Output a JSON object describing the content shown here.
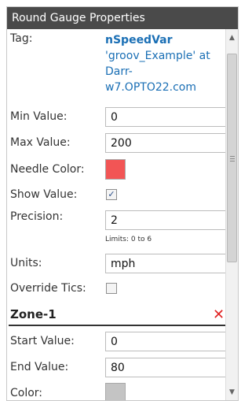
{
  "panel": {
    "title": "Round Gauge Properties"
  },
  "tag": {
    "label": "Tag:",
    "name": "nSpeedVar",
    "source_line1": "'groov_Example' at",
    "source_line2": "Darr-",
    "source_line3": "w7.OPTO22.com"
  },
  "min_value": {
    "label": "Min Value:",
    "value": "0"
  },
  "max_value": {
    "label": "Max Value:",
    "value": "200"
  },
  "needle_color": {
    "label": "Needle Color:",
    "color": "#f25555"
  },
  "show_value": {
    "label": "Show Value:",
    "checked": true,
    "check_glyph": "✓"
  },
  "precision": {
    "label": "Precision:",
    "value": "2",
    "limits": "Limits: 0 to 6"
  },
  "units": {
    "label": "Units:",
    "value": "mph"
  },
  "override_tics": {
    "label": "Override Tics:",
    "checked": false
  },
  "zone1": {
    "title": "Zone-1",
    "delete_glyph": "✕",
    "start_label": "Start Value:",
    "start_value": "0",
    "end_label": "End Value:",
    "end_value": "80",
    "color_label": "Color:",
    "color": "#c4c4c4"
  },
  "scrollbar": {
    "up_glyph": "▲",
    "down_glyph": "▼"
  }
}
